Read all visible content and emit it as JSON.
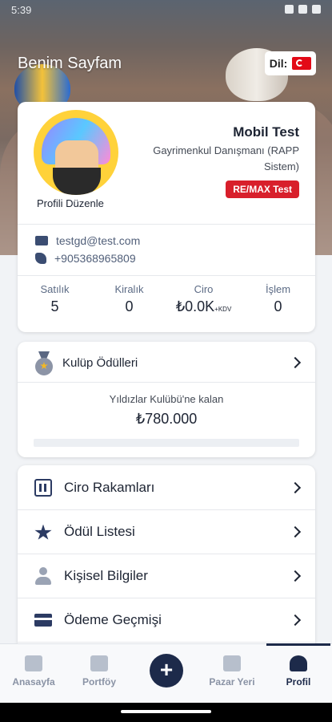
{
  "status_bar": {
    "time": "5:39"
  },
  "header": {
    "title": "Benim Sayfam",
    "language_label": "Dil:",
    "language_flag_icon": "turkey-flag-icon"
  },
  "profile": {
    "name": "Mobil Test",
    "title": "Gayrimenkul Danışmanı (RAPP Sistem)",
    "badge": "RE/MAX Test",
    "edit_label": "Profili Düzenle",
    "email": "testgd@test.com",
    "phone": "+905368965809",
    "stats": [
      {
        "label": "Satılık",
        "value": "5"
      },
      {
        "label": "Kiralık",
        "value": "0"
      },
      {
        "label": "Ciro",
        "value": "₺0.0K",
        "suffix": "+KDV"
      },
      {
        "label": "İşlem",
        "value": "0"
      }
    ]
  },
  "club": {
    "title": "Kulüp Ödülleri",
    "subtitle": "Yıldızlar Kulübü'ne kalan",
    "amount": "₺780.000",
    "progress_fraction": 0.0
  },
  "menu": [
    {
      "label": "Ciro Rakamları",
      "icon": "calculator-icon"
    },
    {
      "label": "Ödül Listesi",
      "icon": "award-icon"
    },
    {
      "label": "Kişisel Bilgiler",
      "icon": "user-icon"
    },
    {
      "label": "Ödeme Geçmişi",
      "icon": "credit-card-icon"
    }
  ],
  "bottom_nav": [
    {
      "label": "Anasayfa",
      "icon": "home-icon"
    },
    {
      "label": "Portföy",
      "icon": "portfolio-icon"
    },
    {
      "label": "+",
      "icon": "add-icon"
    },
    {
      "label": "Pazar Yeri",
      "icon": "map-icon"
    },
    {
      "label": "Profil",
      "icon": "profile-icon"
    }
  ],
  "colors": {
    "accent": "#1d2a4a",
    "badge": "#d81f2b",
    "background": "#f1f3f6"
  }
}
